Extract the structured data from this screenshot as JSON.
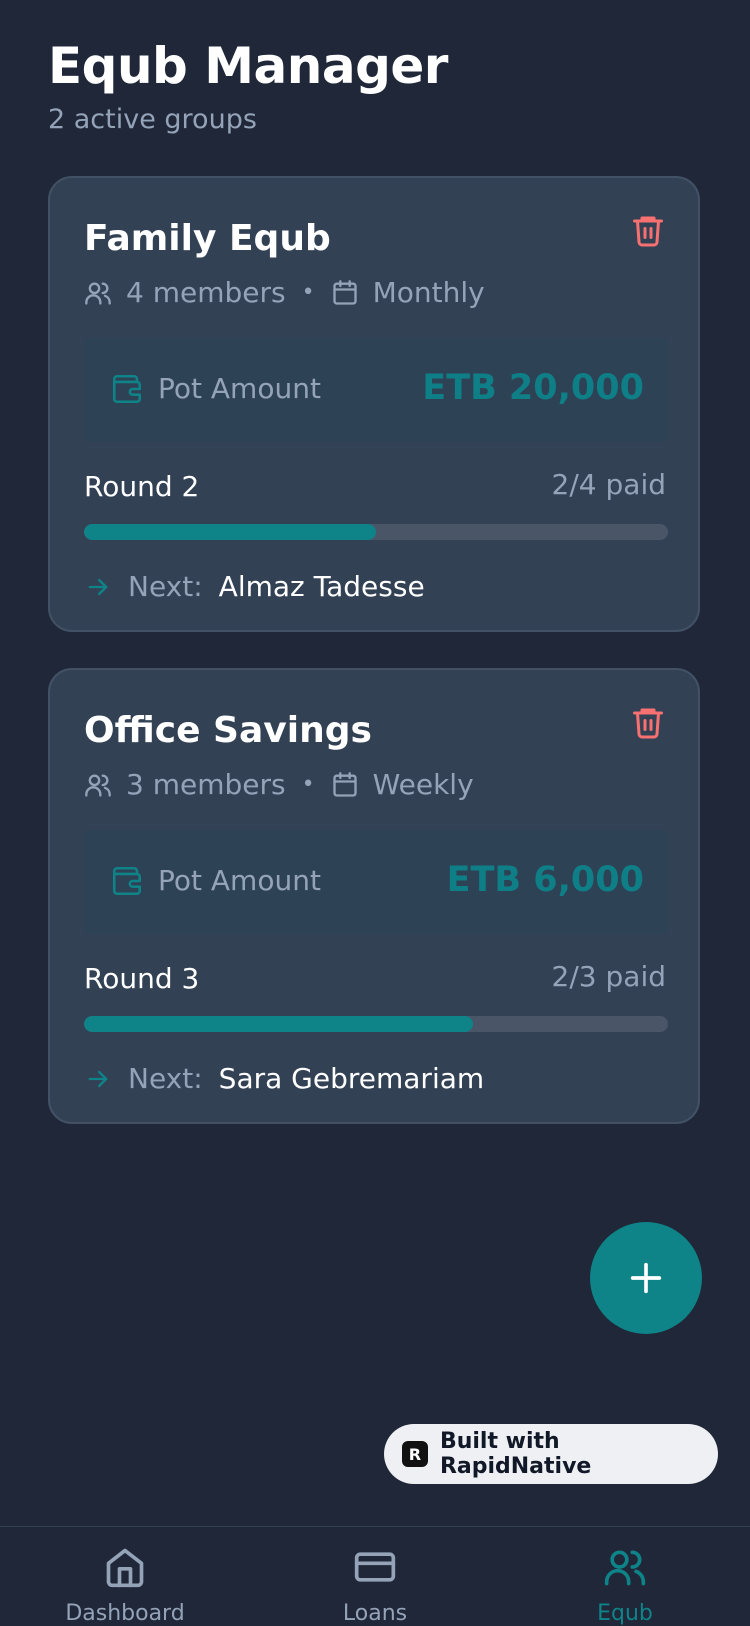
{
  "header": {
    "title": "Equb Manager",
    "subtitle": "2 active groups"
  },
  "groups": [
    {
      "name": "Family Equb",
      "members": "4 members",
      "frequency": "Monthly",
      "pot_label": "Pot Amount",
      "pot_amount": "ETB 20,000",
      "round": "Round 2",
      "paid": "2/4 paid",
      "progress": 0.5,
      "next_label": "Next:",
      "next_name": "Almaz Tadesse"
    },
    {
      "name": "Office Savings",
      "members": "3 members",
      "frequency": "Weekly",
      "pot_label": "Pot Amount",
      "pot_amount": "ETB 6,000",
      "round": "Round 3",
      "paid": "2/3 paid",
      "progress": 0.6667,
      "next_label": "Next:",
      "next_name": "Sara Gebremariam"
    }
  ],
  "fab": {
    "icon": "plus-icon"
  },
  "badge": {
    "label": "Built with RapidNative"
  },
  "nav": [
    {
      "label": "Dashboard",
      "icon": "home-icon",
      "active": false
    },
    {
      "label": "Loans",
      "icon": "credit-card-icon",
      "active": false
    },
    {
      "label": "Equb",
      "icon": "users-icon",
      "active": true
    }
  ],
  "colors": {
    "accent": "#0e8388",
    "danger": "#f87171",
    "muted": "#94a3b8",
    "background": "#1f2738",
    "card": "#334155"
  }
}
